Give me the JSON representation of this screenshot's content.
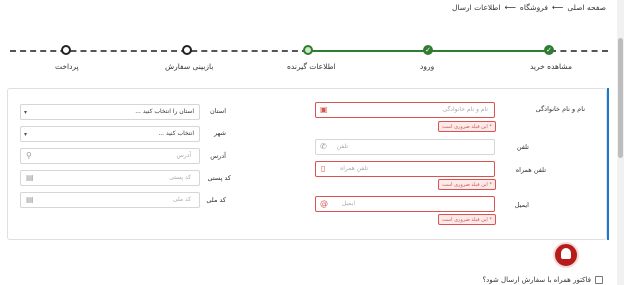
{
  "breadcrumb": {
    "home": "صفحه اصلی",
    "store": "فروشگاه",
    "current": "اطلاعات ارسال"
  },
  "steps": [
    {
      "label": "مشاهده خرید",
      "state": "done"
    },
    {
      "label": "ورود",
      "state": "done"
    },
    {
      "label": "اطلاعات گیرنده",
      "state": "current"
    },
    {
      "label": "بازبینی سفارش",
      "state": "todo"
    },
    {
      "label": "پرداخت",
      "state": "todo"
    }
  ],
  "colors": {
    "accent_green": "#2e7d32",
    "error_red": "#d9534f",
    "bell_red": "#b71c1c",
    "card_accent_blue": "#1976d2"
  },
  "form": {
    "fullname": {
      "label": "نام و نام خانوادگی",
      "placeholder": "نام و نام خانوادگی",
      "error": "* این فیلد ضروری است"
    },
    "phone": {
      "label": "تلفن",
      "placeholder": "تلفن"
    },
    "mobile": {
      "label": "تلفن همراه",
      "placeholder": "تلفن همراه",
      "error": "* این فیلد ضروری است"
    },
    "email": {
      "label": "ایمیل",
      "placeholder": "ایمیل",
      "error": "* این فیلد ضروری است"
    },
    "province": {
      "label": "استان",
      "value": "استان را انتخاب کنید ..."
    },
    "city": {
      "label": "شهر",
      "value": "انتخاب کنید ..."
    },
    "address": {
      "label": "آدرس",
      "placeholder": "آدرس"
    },
    "postal": {
      "label": "کد پستی",
      "placeholder": "کد پستی"
    },
    "national": {
      "label": "کد ملی",
      "placeholder": "کد ملی"
    }
  },
  "invoice_question": "فاکتور همراه با سفارش ارسال شود؟",
  "icons": {
    "fullname": "id-card-icon",
    "phone": "phone-icon",
    "mobile": "mobile-icon",
    "email": "at-sign-icon",
    "address": "location-pin-icon",
    "postal": "document-icon",
    "national": "document-icon",
    "bell": "bell-icon"
  }
}
